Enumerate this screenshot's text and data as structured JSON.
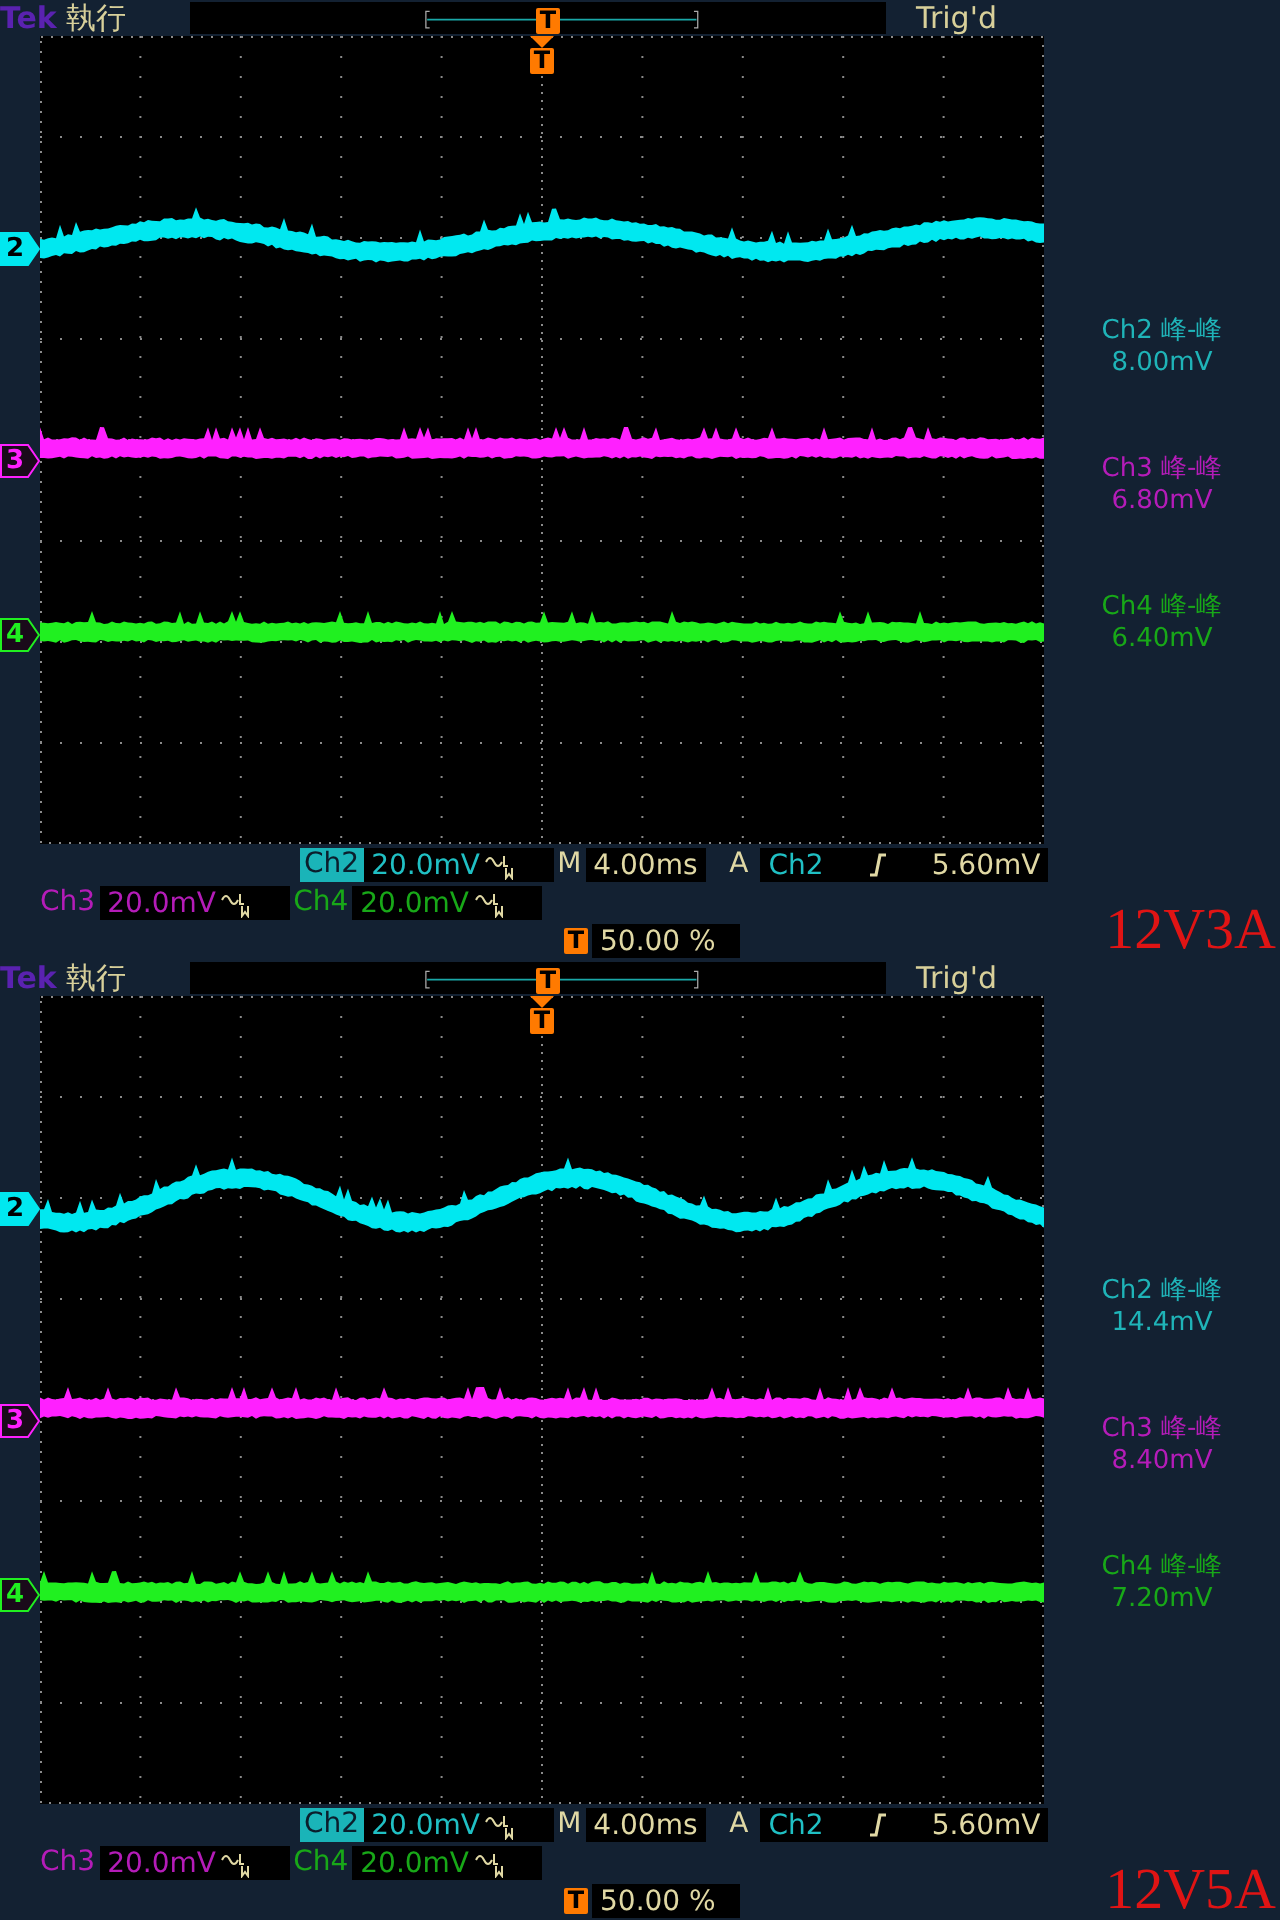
{
  "panels": [
    {
      "header": {
        "brand": "Tek",
        "status": "執行",
        "record_marker": "T",
        "trigger_state": "Trig'd"
      },
      "graticule": {
        "trigger_marker": "T"
      },
      "traces": [
        {
          "channel": "2",
          "kind": "sine",
          "selected": true,
          "color": "#00e8f0"
        },
        {
          "channel": "3",
          "kind": "flat",
          "selected": false,
          "color": "#ff20ff"
        },
        {
          "channel": "4",
          "kind": "flat",
          "selected": false,
          "color": "#20f020"
        }
      ],
      "measurements": [
        {
          "label": "Ch2 峰-峰",
          "value": "8.00mV",
          "color": "#1fb4b8"
        },
        {
          "label": "Ch3 峰-峰",
          "value": "6.80mV",
          "color": "#b41cb8"
        },
        {
          "label": "Ch4 峰-峰",
          "value": "6.40mV",
          "color": "#18a818"
        }
      ],
      "channel_settings": [
        {
          "label": "Ch2",
          "scale": "20.0mV",
          "selected": true,
          "color": "#20c0c4"
        },
        {
          "label": "Ch3",
          "scale": "20.0mV",
          "selected": false,
          "color": "#b41cb8"
        },
        {
          "label": "Ch4",
          "scale": "20.0mV",
          "selected": false,
          "color": "#18a818"
        }
      ],
      "timebase": {
        "label": "M",
        "value": "4.00ms"
      },
      "trigger": {
        "mode": "A",
        "source": "Ch2",
        "level": "5.60mV"
      },
      "trigger_position": {
        "marker": "T",
        "value": "50.00 %"
      },
      "caption": "12V3A"
    },
    {
      "header": {
        "brand": "Tek",
        "status": "執行",
        "record_marker": "T",
        "trigger_state": "Trig'd"
      },
      "graticule": {
        "trigger_marker": "T"
      },
      "traces": [
        {
          "channel": "2",
          "kind": "sine",
          "selected": true,
          "color": "#00e8f0"
        },
        {
          "channel": "3",
          "kind": "flat",
          "selected": false,
          "color": "#ff20ff"
        },
        {
          "channel": "4",
          "kind": "flat",
          "selected": false,
          "color": "#20f020"
        }
      ],
      "measurements": [
        {
          "label": "Ch2 峰-峰",
          "value": "14.4mV",
          "color": "#1fb4b8"
        },
        {
          "label": "Ch3 峰-峰",
          "value": "8.40mV",
          "color": "#b41cb8"
        },
        {
          "label": "Ch4 峰-峰",
          "value": "7.20mV",
          "color": "#18a818"
        }
      ],
      "channel_settings": [
        {
          "label": "Ch2",
          "scale": "20.0mV",
          "selected": true,
          "color": "#20c0c4"
        },
        {
          "label": "Ch3",
          "scale": "20.0mV",
          "selected": false,
          "color": "#b41cb8"
        },
        {
          "label": "Ch4",
          "scale": "20.0mV",
          "selected": false,
          "color": "#18a818"
        }
      ],
      "timebase": {
        "label": "M",
        "value": "4.00ms"
      },
      "trigger": {
        "mode": "A",
        "source": "Ch2",
        "level": "5.60mV"
      },
      "trigger_position": {
        "marker": "T",
        "value": "50.00 %"
      },
      "caption": "12V5A"
    }
  ]
}
